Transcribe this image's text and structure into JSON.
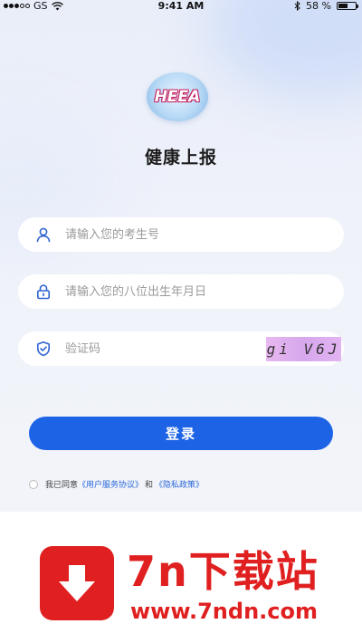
{
  "status_bar": {
    "carrier": "GS",
    "time": "9:41 AM",
    "battery_text": "58 %",
    "battery_level": 0.58
  },
  "logo": {
    "text": "HEEA"
  },
  "title": "健康上报",
  "form": {
    "exam_number_placeholder": "请输入您的考生号",
    "birthdate_placeholder": "请输入您的八位出生年月日",
    "captcha_placeholder": "验证码",
    "captcha_text": "gi V6J",
    "login_label": "登录"
  },
  "agreement": {
    "prefix": "我已同意",
    "user_agreement": "《用户服务协议》",
    "and": "和",
    "privacy_policy": "《隐私政策》"
  },
  "watermark": {
    "title": "7n下载站",
    "url": "www.7ndn.com"
  },
  "colors": {
    "primary": "#1c63e6",
    "link": "#2a68d8",
    "watermark_red": "#e02020",
    "icon_blue": "#2f63d1"
  },
  "icons": [
    "user-icon",
    "lock-icon",
    "shield-icon",
    "wifi-icon",
    "bluetooth-icon",
    "battery-icon",
    "download-arrow-icon"
  ]
}
